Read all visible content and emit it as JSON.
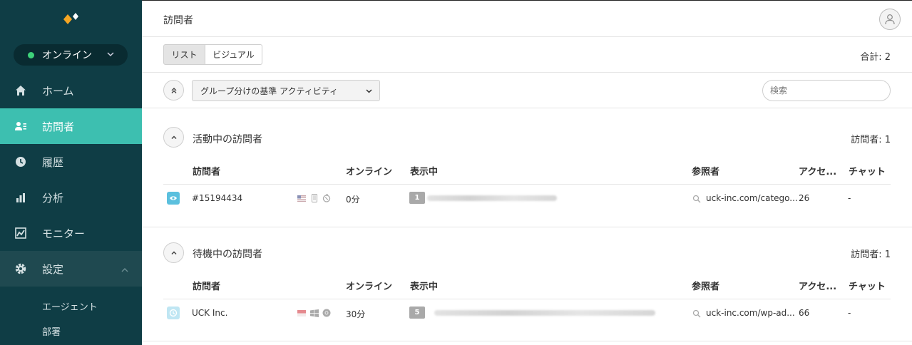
{
  "sidebar": {
    "status_label": "オンライン",
    "items": [
      {
        "label": "ホーム",
        "icon": "home-icon"
      },
      {
        "label": "訪問者",
        "icon": "visitors-icon"
      },
      {
        "label": "履歴",
        "icon": "clock-icon"
      },
      {
        "label": "分析",
        "icon": "bar-chart-icon"
      },
      {
        "label": "モニター",
        "icon": "monitor-chart-icon"
      },
      {
        "label": "設定",
        "icon": "gear-icon"
      }
    ],
    "sub_items": [
      "エージェント",
      "部署"
    ]
  },
  "header": {
    "title": "訪問者"
  },
  "toolbar": {
    "tab_list": "リスト",
    "tab_visual": "ビジュアル",
    "total": "合計: 2"
  },
  "filter": {
    "group_by": "グループ分けの基準 アクティビティ",
    "search_placeholder": "検索"
  },
  "columns": {
    "visitor": "訪問者",
    "online": "オンライン",
    "viewing": "表示中",
    "referrer": "参照者",
    "access": "アクセ...",
    "chat": "チャット"
  },
  "sections": [
    {
      "title": "活動中の訪問者",
      "count": "訪問者: 1",
      "rows": [
        {
          "visitor": "#15194434",
          "online": "0分",
          "page_count": "1",
          "referrer": "uck-inc.com/catego...",
          "access": "26",
          "chat": "-"
        }
      ]
    },
    {
      "title": "待機中の訪問者",
      "count": "訪問者: 1",
      "rows": [
        {
          "visitor": "UCK Inc.",
          "online": "30分",
          "page_count": "5",
          "referrer": "uck-inc.com/wp-ad...",
          "access": "66",
          "chat": "-"
        }
      ]
    }
  ],
  "colors": {
    "sidebar_bg": "#0f3d45",
    "active_teal": "#3dbfb0",
    "online_green": "#3dd37a",
    "logo_orange": "#f5a623"
  }
}
